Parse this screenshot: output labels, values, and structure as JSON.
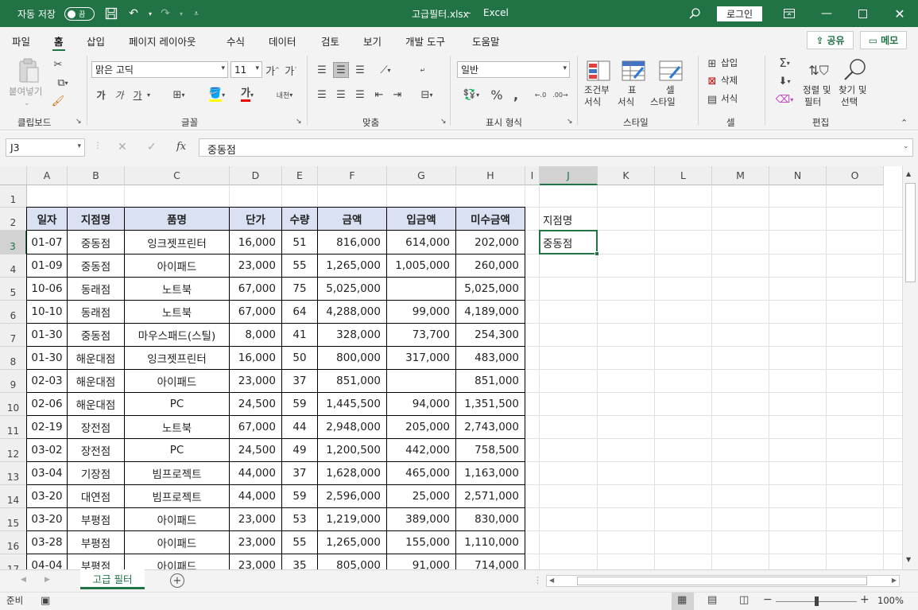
{
  "titlebar": {
    "autosave_label": "자동 저장",
    "autosave_state": "끔",
    "file_title": "고급필터.xlsx",
    "app_name": "Excel",
    "login_label": "로그인"
  },
  "menu": {
    "tabs": [
      "파일",
      "홈",
      "삽입",
      "페이지 레이아웃",
      "수식",
      "데이터",
      "검토",
      "보기",
      "개발 도구",
      "도움말"
    ],
    "active_tab": "홈",
    "share_label": "공유",
    "memo_label": "메모"
  },
  "ribbon": {
    "clipboard": {
      "paste_label": "붙여넣기",
      "group_label": "클립보드"
    },
    "font": {
      "font_name": "맑은 고딕",
      "font_size": "11",
      "bold": "가",
      "italic": "가",
      "underline": "가",
      "group_label": "글꼴"
    },
    "alignment": {
      "group_label": "맞춤"
    },
    "number": {
      "format": "일반",
      "group_label": "표시 형식"
    },
    "styles": {
      "cond_format_1": "조건부",
      "cond_format_2": "서식",
      "table_1": "표",
      "table_2": "서식",
      "cell_1": "셀",
      "cell_2": "스타일",
      "group_label": "스타일"
    },
    "cells": {
      "insert": "삽입",
      "delete": "삭제",
      "format": "서식",
      "group_label": "셀"
    },
    "editing": {
      "sort_1": "정렬 및",
      "sort_2": "필터",
      "find_1": "찾기 및",
      "find_2": "선택",
      "group_label": "편집"
    }
  },
  "formula_bar": {
    "name_box": "J3",
    "fx": "fx",
    "content": "중동점"
  },
  "sheet": {
    "columns": [
      "A",
      "B",
      "C",
      "D",
      "E",
      "F",
      "G",
      "H",
      "I",
      "J",
      "K",
      "L",
      "M",
      "N",
      "O"
    ],
    "row_numbers": [
      "1",
      "2",
      "3",
      "4",
      "5",
      "6",
      "7",
      "8",
      "9",
      "10",
      "11",
      "12",
      "13",
      "14",
      "15",
      "16",
      "17"
    ],
    "selected_column": "J",
    "selected_row": "3",
    "table_headers": [
      "일자",
      "지점명",
      "품명",
      "단가",
      "수량",
      "금액",
      "입금액",
      "미수금액"
    ],
    "rows": [
      [
        "01-07",
        "중동점",
        "잉크젯프린터",
        "16,000",
        "51",
        "816,000",
        "614,000",
        "202,000"
      ],
      [
        "01-09",
        "중동점",
        "아이패드",
        "23,000",
        "55",
        "1,265,000",
        "1,005,000",
        "260,000"
      ],
      [
        "10-06",
        "동래점",
        "노트북",
        "67,000",
        "75",
        "5,025,000",
        "",
        "5,025,000"
      ],
      [
        "10-10",
        "동래점",
        "노트북",
        "67,000",
        "64",
        "4,288,000",
        "99,000",
        "4,189,000"
      ],
      [
        "01-30",
        "중동점",
        "마우스패드(스틸)",
        "8,000",
        "41",
        "328,000",
        "73,700",
        "254,300"
      ],
      [
        "01-30",
        "해운대점",
        "잉크젯프린터",
        "16,000",
        "50",
        "800,000",
        "317,000",
        "483,000"
      ],
      [
        "02-03",
        "해운대점",
        "아이패드",
        "23,000",
        "37",
        "851,000",
        "",
        "851,000"
      ],
      [
        "02-06",
        "해운대점",
        "PC",
        "24,500",
        "59",
        "1,445,500",
        "94,000",
        "1,351,500"
      ],
      [
        "02-19",
        "장전점",
        "노트북",
        "67,000",
        "44",
        "2,948,000",
        "205,000",
        "2,743,000"
      ],
      [
        "03-02",
        "장전점",
        "PC",
        "24,500",
        "49",
        "1,200,500",
        "442,000",
        "758,500"
      ],
      [
        "03-04",
        "기장점",
        "빔프로젝트",
        "44,000",
        "37",
        "1,628,000",
        "465,000",
        "1,163,000"
      ],
      [
        "03-20",
        "대연점",
        "빔프로젝트",
        "44,000",
        "59",
        "2,596,000",
        "25,000",
        "2,571,000"
      ],
      [
        "03-20",
        "부평점",
        "아이패드",
        "23,000",
        "53",
        "1,219,000",
        "389,000",
        "830,000"
      ],
      [
        "03-28",
        "부평점",
        "아이패드",
        "23,000",
        "55",
        "1,265,000",
        "155,000",
        "1,110,000"
      ],
      [
        "04-04",
        "부평점",
        "아이패드",
        "23,000",
        "35",
        "805,000",
        "91,000",
        "714,000"
      ]
    ],
    "criteria_header": "지점명",
    "criteria_value": "중동점",
    "header_fill": "#d9e1f2"
  },
  "sheet_tabs": {
    "active": "고급 필터"
  },
  "status": {
    "mode": "준비",
    "zoom": "100%"
  },
  "colors": {
    "accent": "#217346"
  }
}
